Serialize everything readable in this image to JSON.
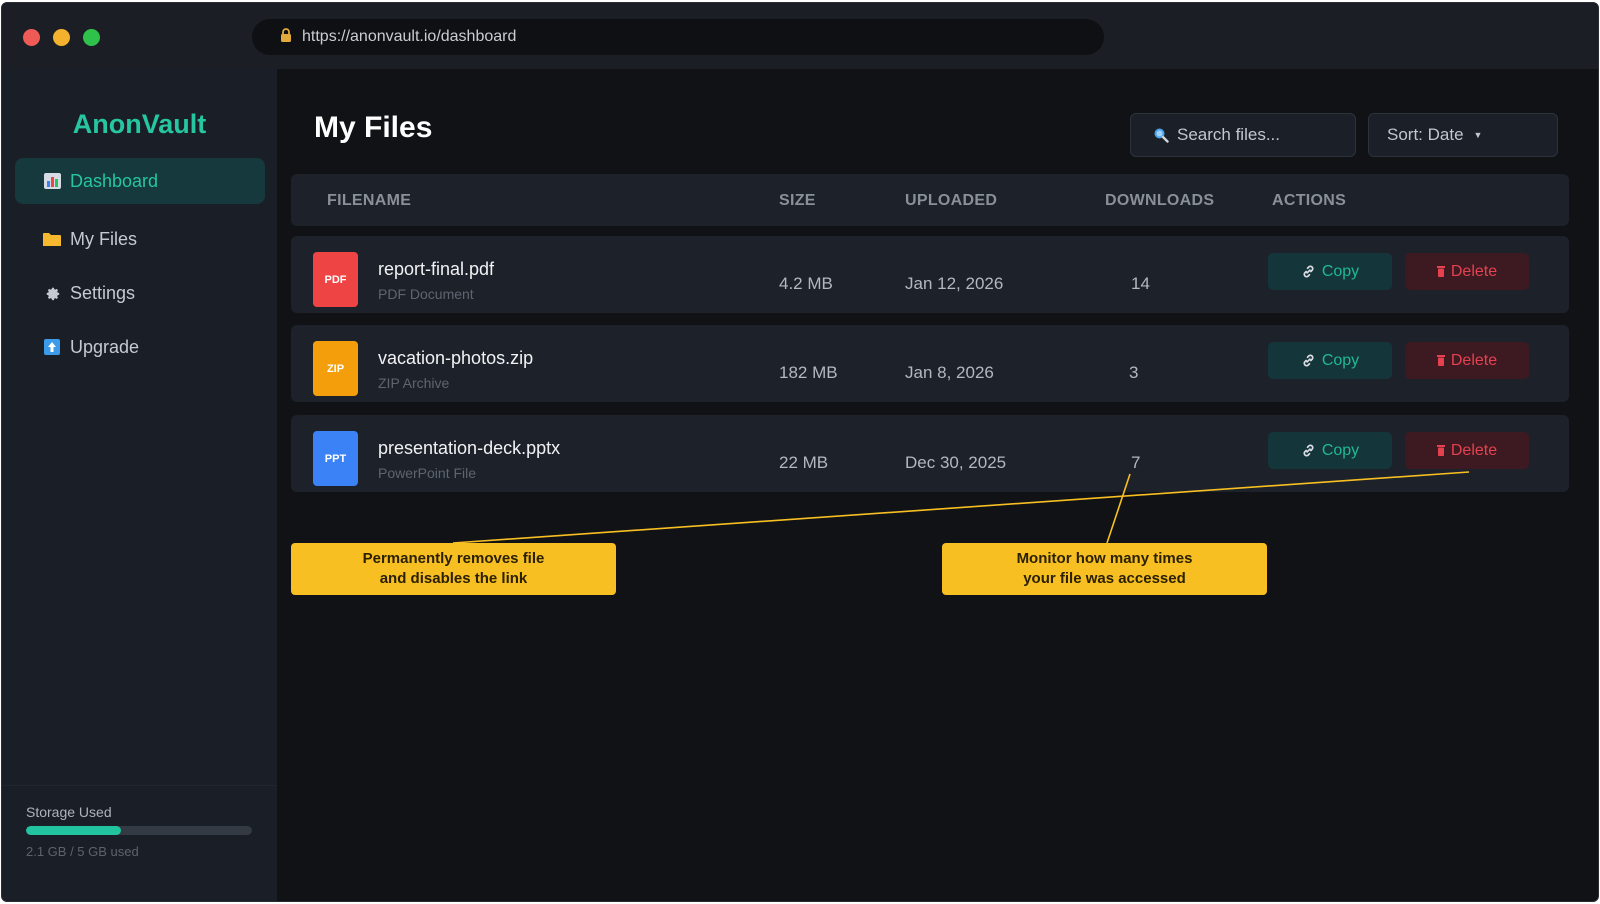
{
  "browser": {
    "url": "https://anonvault.io/dashboard"
  },
  "sidebar": {
    "brand": "AnonVault",
    "items": [
      {
        "label": "Dashboard",
        "icon": "bar-chart-icon",
        "active": true
      },
      {
        "label": "My Files",
        "icon": "folder-icon",
        "active": false
      },
      {
        "label": "Settings",
        "icon": "gear-icon",
        "active": false
      },
      {
        "label": "Upgrade",
        "icon": "upgrade-arrow-icon",
        "active": false
      }
    ],
    "storage": {
      "label": "Storage Used",
      "text": "2.1 GB / 5 GB used",
      "fraction": 0.42
    }
  },
  "main": {
    "title": "My Files",
    "search_placeholder": "Search files...",
    "sort_label": "Sort: Date",
    "columns": [
      "FILENAME",
      "SIZE",
      "UPLOADED",
      "DOWNLOADS",
      "ACTIONS"
    ],
    "copy_label": "Copy",
    "delete_label": "Delete",
    "files": [
      {
        "badge": "PDF",
        "badge_color": "#ef4444",
        "name": "report-final.pdf",
        "type": "PDF Document",
        "size": "4.2 MB",
        "uploaded": "Jan 12, 2026",
        "downloads": "14"
      },
      {
        "badge": "ZIP",
        "badge_color": "#f59e0b",
        "name": "vacation-photos.zip",
        "type": "ZIP Archive",
        "size": "182 MB",
        "uploaded": "Jan 8, 2026",
        "downloads": "3"
      },
      {
        "badge": "PPT",
        "badge_color": "#3b82f6",
        "name": "presentation-deck.pptx",
        "type": "PowerPoint File",
        "size": "22 MB",
        "uploaded": "Dec 30, 2025",
        "downloads": "7"
      }
    ]
  },
  "callouts": [
    {
      "text": "Permanently removes file\nand disables the link"
    },
    {
      "text": "Monitor how many times\nyour file was accessed"
    }
  ],
  "colors": {
    "accent": "#25c6a0",
    "danger": "#e5414f",
    "callout": "#f7bf22"
  }
}
